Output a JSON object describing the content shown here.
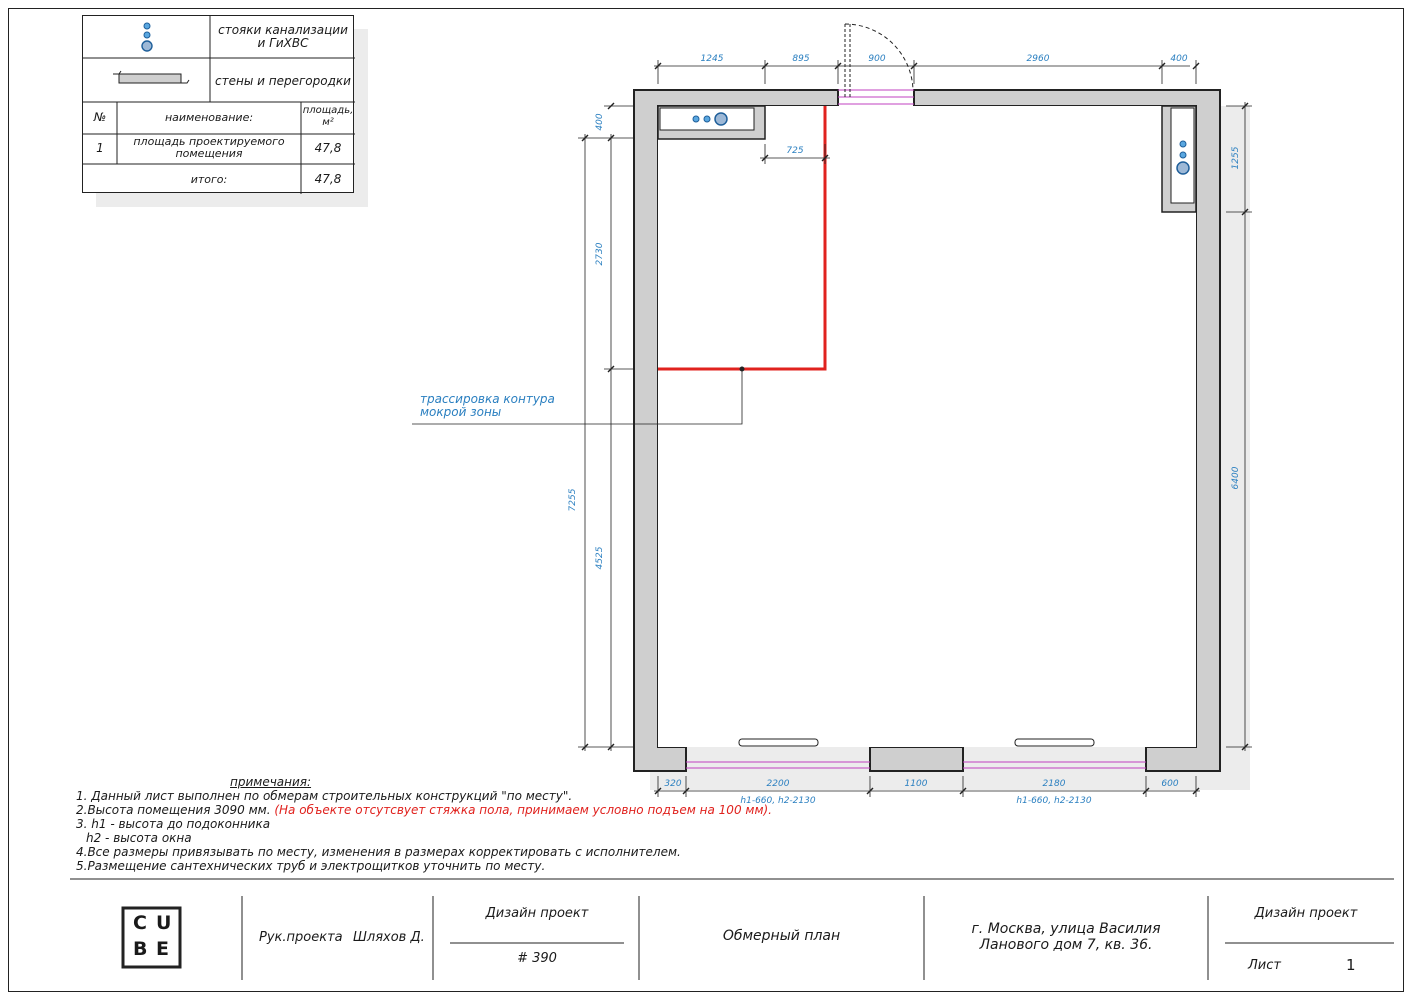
{
  "legend": {
    "risers_label": "стояки канализации и ГиХВС",
    "walls_label": "стены и перегородки",
    "col_num": "№",
    "col_name": "наименование:",
    "col_area": "площадь, м²",
    "row1_num": "1",
    "row1_name": "площадь проектируемого помещения",
    "row1_area": "47,8",
    "total_label": "итого:",
    "total_area": "47,8"
  },
  "dims": {
    "top": [
      "1245",
      "895",
      "900",
      "2960",
      "400"
    ],
    "inner_725": "725",
    "left_outer": "7255",
    "left_inner": [
      "400",
      "2730",
      "4525"
    ],
    "right": [
      "1255",
      "6400"
    ],
    "bottom": [
      "320",
      "2200",
      "1100",
      "2180",
      "600"
    ],
    "window_heights": [
      "h1-660, h2-2130",
      "h1-660, h2-2130"
    ]
  },
  "wet_zone_label": "трассировка контура мокрой зоны",
  "notes": {
    "heading": "примечания:",
    "n1": "1. Данный лист выполнен по обмерам строительных конструкций \"по месту\".",
    "n2a": "2.Высота помещения 3090 мм. ",
    "n2b": "(На объекте отсутсвует стяжка пола, принимаем условно подъем на 100 мм).",
    "n3": "3. h1 - высота до подоконника",
    "n3b": "h2 - высота окна",
    "n4": "4.Все размеры привязывать по месту, изменения в размерах корректировать с исполнителем.",
    "n5": "5.Размещение сантехнических труб и электрощитков уточнить по месту."
  },
  "titleblock": {
    "logo": [
      "C",
      "U",
      "B",
      "E"
    ],
    "role": "Рук.проекта",
    "author": "Шляхов Д.",
    "project_type": "Дизайн проект",
    "project_no": "# 390",
    "sheet_title": "Обмерный план",
    "address_1": "г. Москва, улица Василия",
    "address_2": "Ланового дом 7, кв. 36.",
    "stage": "Дизайн проект",
    "sheet_label": "Лист",
    "sheet_no": "1"
  },
  "colors": {
    "wall_fill": "#cfcfcf",
    "wet_zone": "#e0221e",
    "dim_blue": "#2a7fc0",
    "window": "#c040c0",
    "riser": "#5aa7e0"
  }
}
